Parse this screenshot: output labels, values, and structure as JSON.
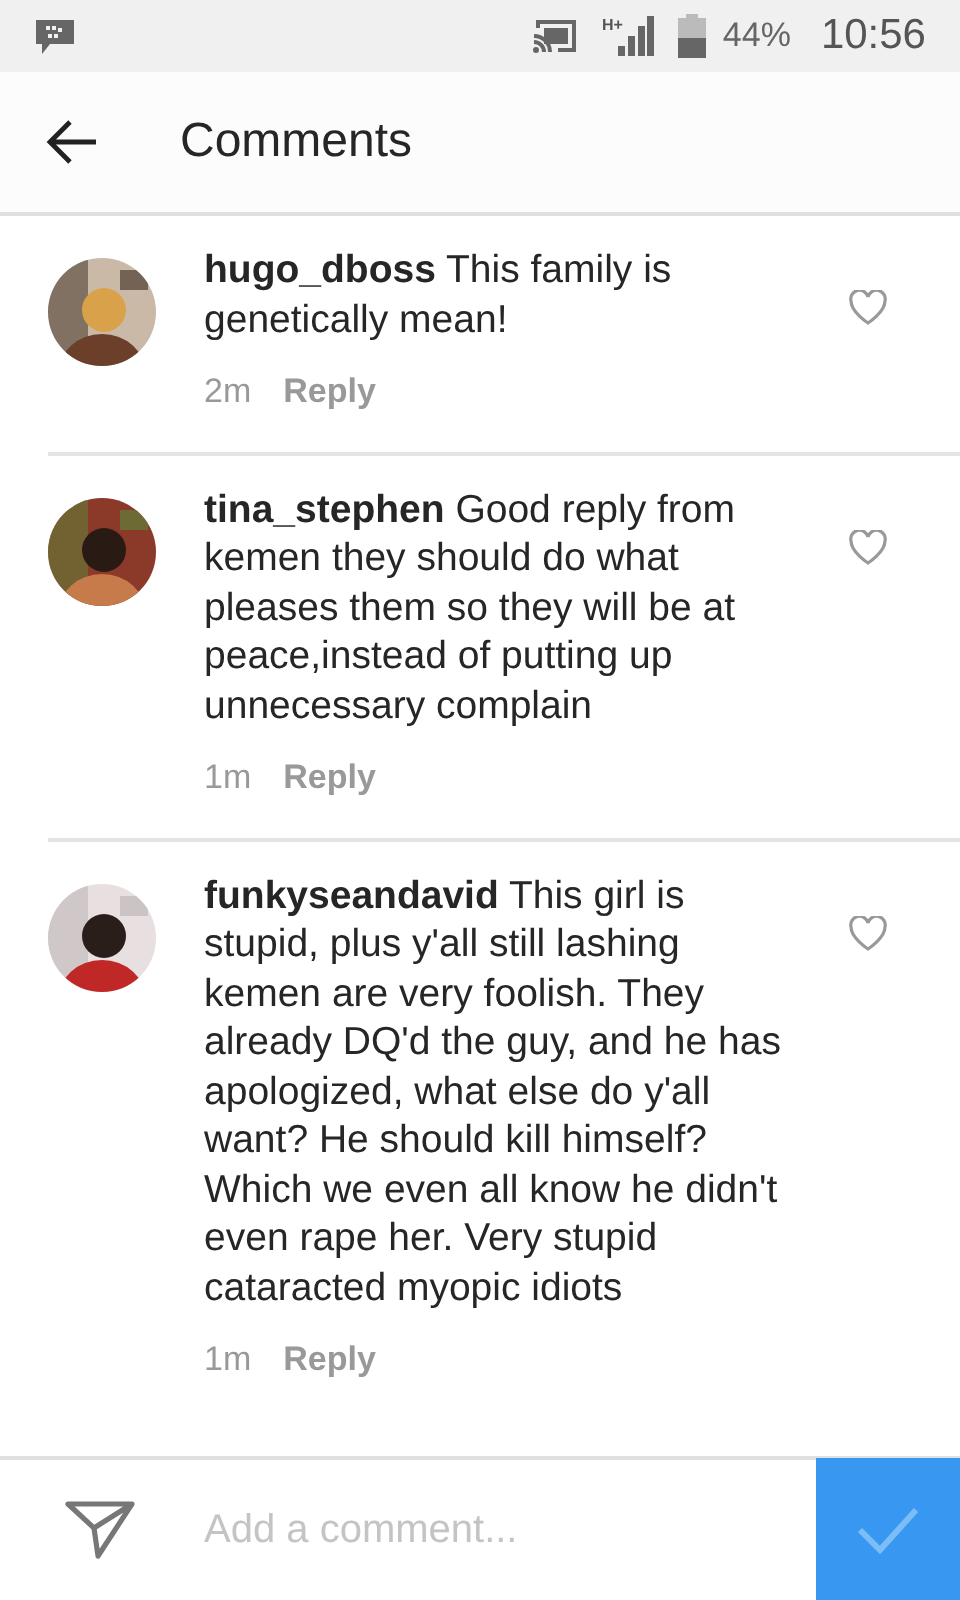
{
  "status_bar": {
    "network": "H+",
    "battery": "44%",
    "time": "10:56"
  },
  "header": {
    "title": "Comments"
  },
  "comments": [
    {
      "username": "hugo_dboss",
      "text": "This family is genetically mean!",
      "time": "2m",
      "reply": "Reply",
      "liked": false
    },
    {
      "username": "tina_stephen",
      "text": "Good reply from kemen they should do what pleases them so they will be at peace,instead of putting up unnecessary complain",
      "time": "1m",
      "reply": "Reply",
      "liked": false
    },
    {
      "username": "funkyseandavid",
      "text": "This girl is stupid, plus y'all still lashing kemen are very foolish. They already DQ'd the guy, and he has apologized, what else do y'all want? He should kill himself? Which we even all know he didn't even rape her. Very stupid cataracted myopic idiots",
      "time": "1m",
      "reply": "Reply",
      "liked": false
    }
  ],
  "composer": {
    "placeholder": "Add a comment..."
  }
}
